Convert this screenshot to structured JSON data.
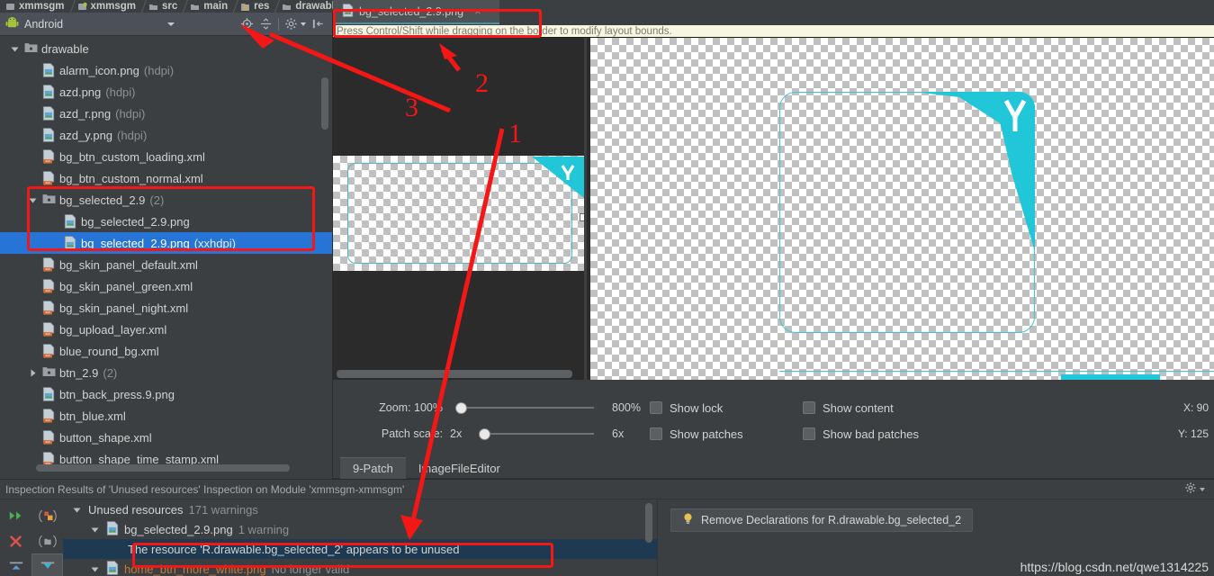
{
  "breadcrumbs": [
    {
      "label": "xmmsgm",
      "icon": "module-icon"
    },
    {
      "label": "xmmsgm",
      "icon": "module-green-icon"
    },
    {
      "label": "src",
      "icon": "folder-icon"
    },
    {
      "label": "main",
      "icon": "folder-icon"
    },
    {
      "label": "res",
      "icon": "res-folder-icon"
    },
    {
      "label": "drawable-xxhdpi",
      "icon": "folder-icon"
    },
    {
      "label": "bg_selected_2.9.png",
      "icon": "png-file-icon"
    }
  ],
  "project_panel": {
    "title": "Android",
    "toolbar": [
      {
        "name": "locate-in-tree-icon",
        "tooltip": "Select Opened File"
      },
      {
        "name": "collapse-all-icon",
        "tooltip": "Collapse All"
      },
      {
        "name": "settings-gear-icon",
        "tooltip": "Settings"
      },
      {
        "name": "hide-panel-icon",
        "tooltip": "Hide"
      }
    ],
    "tree": [
      {
        "indent": 0,
        "twisty": "down",
        "icon": "folder-icon",
        "label": "drawable",
        "qualifier": "",
        "selected": false
      },
      {
        "indent": 1,
        "twisty": "none",
        "icon": "png-file-icon",
        "label": "alarm_icon.png",
        "qualifier": "(hdpi)",
        "selected": false
      },
      {
        "indent": 1,
        "twisty": "none",
        "icon": "png-file-icon",
        "label": "azd.png",
        "qualifier": "(hdpi)",
        "selected": false
      },
      {
        "indent": 1,
        "twisty": "none",
        "icon": "png-file-icon",
        "label": "azd_r.png",
        "qualifier": "(hdpi)",
        "selected": false
      },
      {
        "indent": 1,
        "twisty": "none",
        "icon": "png-file-icon",
        "label": "azd_y.png",
        "qualifier": "(hdpi)",
        "selected": false
      },
      {
        "indent": 1,
        "twisty": "none",
        "icon": "xml-file-icon",
        "label": "bg_btn_custom_loading.xml",
        "qualifier": "",
        "selected": false
      },
      {
        "indent": 1,
        "twisty": "none",
        "icon": "xml-file-icon",
        "label": "bg_btn_custom_normal.xml",
        "qualifier": "",
        "selected": false
      },
      {
        "indent": 1,
        "twisty": "down",
        "icon": "res-group-icon",
        "label": "bg_selected_2.9",
        "qualifier": "(2)",
        "selected": false
      },
      {
        "indent": 2,
        "twisty": "none",
        "icon": "png-file-icon",
        "label": "bg_selected_2.9.png",
        "qualifier": "",
        "selected": false
      },
      {
        "indent": 2,
        "twisty": "none",
        "icon": "png-file-icon",
        "label": "bg_selected_2.9.png",
        "qualifier": "(xxhdpi)",
        "selected": true
      },
      {
        "indent": 1,
        "twisty": "none",
        "icon": "xml-file-icon",
        "label": "bg_skin_panel_default.xml",
        "qualifier": "",
        "selected": false
      },
      {
        "indent": 1,
        "twisty": "none",
        "icon": "xml-file-icon",
        "label": "bg_skin_panel_green.xml",
        "qualifier": "",
        "selected": false
      },
      {
        "indent": 1,
        "twisty": "none",
        "icon": "xml-file-icon",
        "label": "bg_skin_panel_night.xml",
        "qualifier": "",
        "selected": false
      },
      {
        "indent": 1,
        "twisty": "none",
        "icon": "xml-file-icon",
        "label": "bg_upload_layer.xml",
        "qualifier": "",
        "selected": false
      },
      {
        "indent": 1,
        "twisty": "none",
        "icon": "xml-file-icon",
        "label": "blue_round_bg.xml",
        "qualifier": "",
        "selected": false
      },
      {
        "indent": 1,
        "twisty": "right",
        "icon": "res-group-icon",
        "label": "btn_2.9",
        "qualifier": "(2)",
        "selected": false
      },
      {
        "indent": 1,
        "twisty": "none",
        "icon": "png-file-icon",
        "label": "btn_back_press.9.png",
        "qualifier": "",
        "selected": false
      },
      {
        "indent": 1,
        "twisty": "none",
        "icon": "xml-file-icon",
        "label": "btn_blue.xml",
        "qualifier": "",
        "selected": false
      },
      {
        "indent": 1,
        "twisty": "none",
        "icon": "xml-file-icon",
        "label": "button_shape.xml",
        "qualifier": "",
        "selected": false
      },
      {
        "indent": 1,
        "twisty": "none",
        "icon": "xml-file-icon",
        "label": "button_shape_time_stamp.xml",
        "qualifier": "",
        "selected": false
      }
    ]
  },
  "editor": {
    "tab_label": "bg_selected_2.9.png",
    "tab_close": "×",
    "hint_bar": "Press Control/Shift while dragging on the border to modify layout bounds.",
    "controls": {
      "zoom_label": "Zoom: 100%",
      "zoom_max": "800%",
      "patch_scale_label": "Patch scale:",
      "patch_scale_value": "2x",
      "patch_scale_max": "6x",
      "checkboxes": [
        {
          "label": "Show lock",
          "checked": false
        },
        {
          "label": "Show content",
          "checked": false
        },
        {
          "label": "Show patches",
          "checked": false
        },
        {
          "label": "Show bad patches",
          "checked": false
        }
      ],
      "cursor_x": "X:  90",
      "cursor_y": "Y: 125"
    },
    "bottom_tabs": [
      {
        "label": "9-Patch",
        "active": true
      },
      {
        "label": "ImageFileEditor",
        "active": false
      }
    ]
  },
  "inspection": {
    "header": "Inspection Results of 'Unused resources' Inspection on Module 'xmmsgm-xmmsgm'",
    "tools": [
      {
        "name": "rerun-icon"
      },
      {
        "name": "group-by-icon"
      },
      {
        "name": "close-icon"
      },
      {
        "name": "export-icon"
      },
      {
        "name": "collapse-icon"
      },
      {
        "name": "expand-icon"
      }
    ],
    "tree": [
      {
        "indent": 0,
        "twisty": "down",
        "icon": "none",
        "label": "Unused resources",
        "count": "171 warnings",
        "selected": false,
        "orange": false
      },
      {
        "indent": 1,
        "twisty": "down",
        "icon": "png-file-icon",
        "label": "bg_selected_2.9.png",
        "count": "1 warning",
        "selected": false,
        "orange": false
      },
      {
        "indent": 2,
        "twisty": "none",
        "icon": "none",
        "label": "The resource 'R.drawable.bg_selected_2' appears to be unused",
        "count": "",
        "selected": true,
        "orange": false
      },
      {
        "indent": 1,
        "twisty": "down",
        "icon": "png-file-icon",
        "label": "home_btn_more_white.png",
        "count": "No longer valid",
        "selected": false,
        "orange": true
      }
    ],
    "fix_button": "Remove Declarations for R.drawable.bg_selected_2",
    "fix_icon": "lightbulb-icon",
    "watermark": "https://blog.csdn.net/qwe1314225"
  },
  "annotations": [
    {
      "id": "1",
      "label": "1"
    },
    {
      "id": "2",
      "label": "2"
    },
    {
      "id": "3",
      "label": "3"
    }
  ],
  "colors": {
    "selection_blue": "#2675d6",
    "annotation_red": "#f51616",
    "teal": "#21c6d8",
    "panel_bg": "#3c3f41",
    "toolbar_bg": "#4b5059",
    "warn_bar": "#f7f6e2",
    "inspect_sel": "#1d3a52"
  }
}
